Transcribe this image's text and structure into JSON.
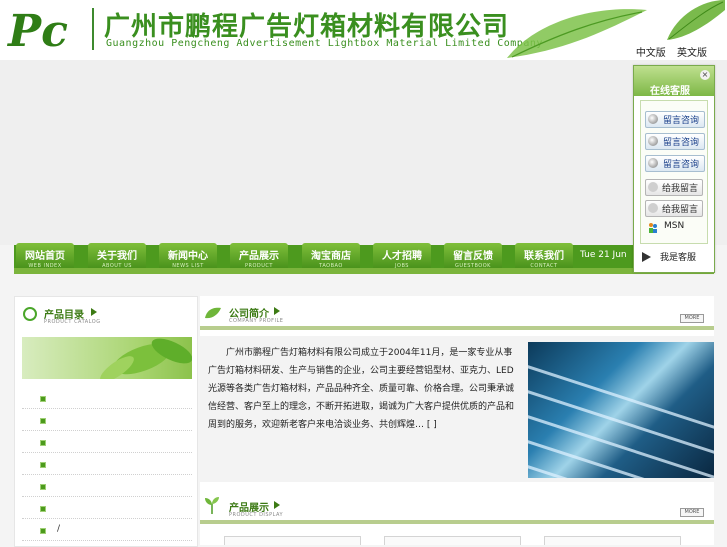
{
  "header": {
    "logo_text": "Pc",
    "company_cn": "广州市鹏程广告灯箱材料有限公司",
    "company_en": "Guangzhou  Pengcheng  Advertisement  Lightbox  Material  Limited Company",
    "lang_links": [
      "中文版",
      "英文版"
    ]
  },
  "nav": {
    "items": [
      {
        "cn": "网站首页",
        "en": "WEB INDEX"
      },
      {
        "cn": "关于我们",
        "en": "ABOUT US"
      },
      {
        "cn": "新闻中心",
        "en": "NEWS LIST"
      },
      {
        "cn": "产品展示",
        "en": "PRODUCT"
      },
      {
        "cn": "淘宝商店",
        "en": "TAOBAO"
      },
      {
        "cn": "人才招聘",
        "en": "JOBS"
      },
      {
        "cn": "留言反馈",
        "en": "GUESTBOOK"
      },
      {
        "cn": "联系我们",
        "en": "CONTACT"
      }
    ],
    "date": "Tue 21 Jun"
  },
  "catalog": {
    "title": "产品目录",
    "subtitle": "PRODUCT CATALOG",
    "items": [
      "",
      "",
      "",
      "",
      "",
      "",
      "/"
    ]
  },
  "intro": {
    "title": "公司简介",
    "subtitle": "COMPANY PROFILE",
    "more": "MORE",
    "text": "广州市鹏程广告灯箱材料有限公司成立于2004年11月，是一家专业从事广告灯箱材料研发、生产与销售的企业，公司主要经营铝型材、亚克力、LED光源等各类广告灯箱材料，产品品种齐全、质量可靠、价格合理。公司秉承诚信经营、客户至上的理念，不断开拓进取，竭诚为广大客户提供优质的产品和周到的服务，欢迎新老客户来电洽谈业务、共创辉煌…",
    "more_link": "[ ]"
  },
  "products": {
    "title": "产品展示",
    "subtitle": "PRODUCT DISPLAY",
    "more": "MORE"
  },
  "kefu": {
    "title": "在线客服",
    "close": "×",
    "qq_buttons": [
      "留言咨询",
      "留言咨询",
      "留言咨询"
    ],
    "msg_buttons": [
      "给我留言",
      "给我留言"
    ],
    "msn": "MSN",
    "bottom": "我是客服"
  },
  "colors": {
    "brand_green": "#3a8f1f",
    "nav_green": "#4d9a1e",
    "line_green": "#b8cd8e"
  }
}
